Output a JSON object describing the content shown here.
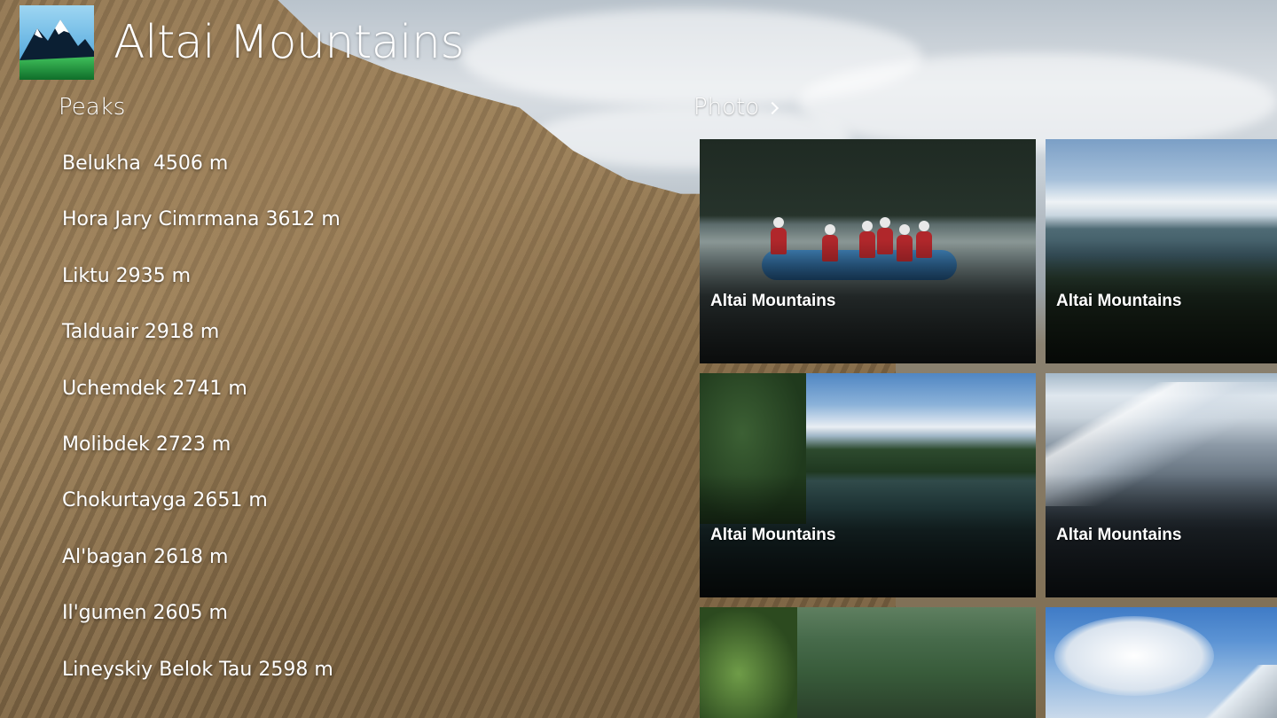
{
  "app": {
    "title": "Altai Mountains",
    "logo_icon": "mountain-logo-icon"
  },
  "peaks": {
    "header": "Peaks",
    "items": [
      "Belukha  4506 m",
      "Hora Jary Cimrmana 3612 m",
      "Liktu 2935 m",
      "Talduair 2918 m",
      "Uchemdek 2741 m",
      "Molibdek 2723 m",
      "Chokurtayga 2651 m",
      "Al'bagan 2618 m",
      "Il'gumen 2605 m",
      "Lineyskiy Belok Tau 2598 m"
    ]
  },
  "photo": {
    "header": "Photo",
    "header_icon": "chevron-right-icon",
    "tiles": [
      {
        "caption": "Altai Mountains"
      },
      {
        "caption": "Altai Mountains"
      },
      {
        "caption": "Altai Mountains"
      },
      {
        "caption": "Altai Mountains"
      },
      {
        "caption": ""
      },
      {
        "caption": ""
      }
    ]
  },
  "colors": {
    "text": "#ffffff",
    "logo_sky": "#5fb6e6",
    "logo_green": "#1f9a3a"
  }
}
